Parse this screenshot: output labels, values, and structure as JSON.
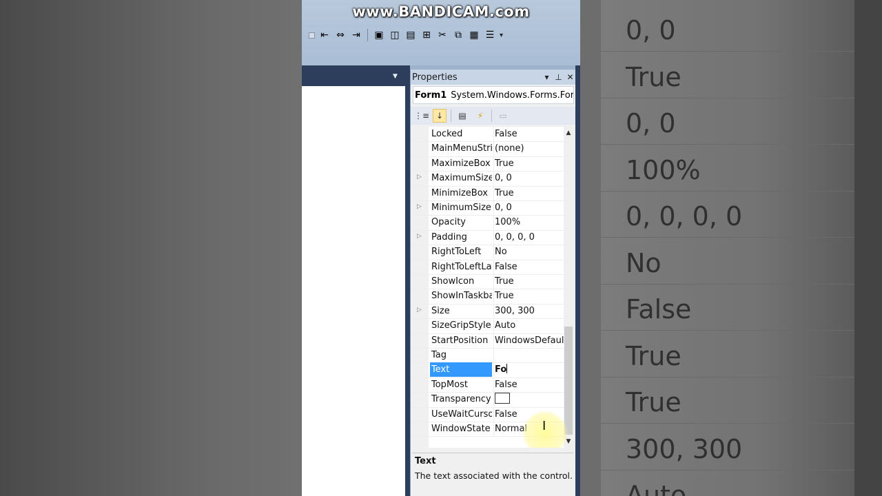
{
  "watermark": "www.BANDICAM.com",
  "background_right_values": [
    "0, 0",
    "True",
    "0, 0",
    "100%",
    "0, 0, 0, 0",
    "No",
    "False",
    "True",
    "True",
    "300, 300",
    "Auto"
  ],
  "toolbar": {
    "icons": [
      "align-left-icon",
      "align-center-icon",
      "align-right-icon",
      "bring-front-icon",
      "send-back-icon",
      "lock-icon",
      "tab-order-icon",
      "cut-icon",
      "copy-icon",
      "paste-icon",
      "delete-icon",
      "properties-icon"
    ]
  },
  "properties": {
    "title": "Properties",
    "pin_symbol": "▾ ▮ ✕",
    "object_name": "Form1",
    "object_type": "System.Windows.Forms.Form",
    "rows": [
      {
        "key": "Locked",
        "value": "False",
        "expandable": false
      },
      {
        "key": "MainMenuStrip",
        "value": "(none)",
        "expandable": false
      },
      {
        "key": "MaximizeBox",
        "value": "True",
        "expandable": false
      },
      {
        "key": "MaximumSize",
        "value": "0, 0",
        "expandable": true
      },
      {
        "key": "MinimizeBox",
        "value": "True",
        "expandable": false
      },
      {
        "key": "MinimumSize",
        "value": "0, 0",
        "expandable": true
      },
      {
        "key": "Opacity",
        "value": "100%",
        "expandable": false
      },
      {
        "key": "Padding",
        "value": "0, 0, 0, 0",
        "expandable": true
      },
      {
        "key": "RightToLeft",
        "value": "No",
        "expandable": false
      },
      {
        "key": "RightToLeftLayout",
        "value": "False",
        "expandable": false
      },
      {
        "key": "ShowIcon",
        "value": "True",
        "expandable": false
      },
      {
        "key": "ShowInTaskbar",
        "value": "True",
        "expandable": false
      },
      {
        "key": "Size",
        "value": "300, 300",
        "expandable": true
      },
      {
        "key": "SizeGripStyle",
        "value": "Auto",
        "expandable": false
      },
      {
        "key": "StartPosition",
        "value": "WindowsDefaultLocation",
        "expandable": false
      },
      {
        "key": "Tag",
        "value": "",
        "expandable": false
      },
      {
        "key": "Text",
        "value": "Fo",
        "expandable": false,
        "selected": true,
        "editing": true
      },
      {
        "key": "TopMost",
        "value": "False",
        "expandable": false
      },
      {
        "key": "TransparencyKey",
        "value": "",
        "expandable": false,
        "swatch": true
      },
      {
        "key": "UseWaitCursor",
        "value": "False",
        "expandable": false
      },
      {
        "key": "WindowState",
        "value": "Normal",
        "expandable": false
      }
    ],
    "description": {
      "title": "Text",
      "text": "The text associated with the control."
    }
  },
  "colors": {
    "selection": "#3399ff",
    "ide_chrome": "#2c3e5b",
    "toolbar_bg": "#b9c9dc"
  }
}
